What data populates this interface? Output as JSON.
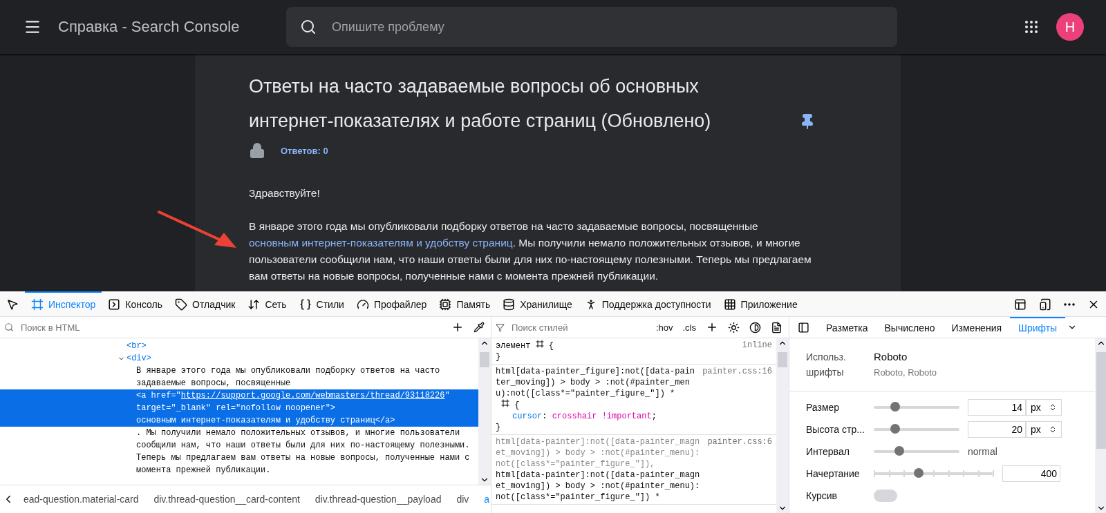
{
  "header": {
    "title": "Справка - Search Console",
    "search_placeholder": "Опишите проблему",
    "avatar_letter": "Н"
  },
  "post": {
    "title": "Ответы на часто задаваемые вопросы об основных интернет-показателях и работе страниц (Обновлено)",
    "replies": "Ответов: 0",
    "greeting": "Здравствуйте!",
    "paragraph_start": "В январе этого года мы опубликовали подборку ответов на часто задаваемые вопросы, посвященные ",
    "paragraph_link": "основным интернет-показателям и удобству страниц",
    "paragraph_end": ". Мы получили немало положительных отзывов, и многие пользователи сообщили нам, что наши ответы были для них по-настоящему полезными. Теперь мы предлагаем вам ответы на новые вопросы, полученные нами с момента прежней публикации."
  },
  "devtools": {
    "tabs": [
      {
        "kind": "inspector",
        "label": "Инспектор",
        "selected": true
      },
      {
        "kind": "console",
        "label": "Консоль",
        "selected": false
      },
      {
        "kind": "debugger",
        "label": "Отладчик",
        "selected": false
      },
      {
        "kind": "network",
        "label": "Сеть",
        "selected": false
      },
      {
        "kind": "styles",
        "label": "Стили",
        "selected": false
      },
      {
        "kind": "profiler",
        "label": "Профайлер",
        "selected": false
      },
      {
        "kind": "memory",
        "label": "Память",
        "selected": false
      },
      {
        "kind": "storage",
        "label": "Хранилище",
        "selected": false
      },
      {
        "kind": "accessibility",
        "label": "Поддержка доступности",
        "selected": false
      },
      {
        "kind": "application",
        "label": "Приложение",
        "selected": false
      }
    ],
    "html_search_placeholder": "Поиск в HTML",
    "html_nodes": [
      {
        "kind": "tag",
        "text": "<br>"
      },
      {
        "kind": "tag",
        "text": "<div>",
        "expanded": true
      },
      {
        "kind": "text",
        "text": "В январе этого года мы опубликовали подборку ответов на часто задаваемые вопросы, посвященные",
        "selected": false
      },
      {
        "kind": "element",
        "selected": true,
        "tag_start": "<a href=\"",
        "url": "https://support.google.com/webmasters/thread/93118226",
        "tag_quote": "\"",
        "attrs": "target=\"_blank\" rel=\"nofollow noopener\">",
        "content": "основным интернет-показателям и удобству страниц</a>"
      },
      {
        "kind": "text",
        "text": ". Мы получили немало положительных отзывов, и многие пользователи сообщили нам, что наши ответы были для них по-настоящему полезными. Теперь мы предлагаем вам ответы на новые вопросы, полученные нами с момента прежней публикации.",
        "selected": false
      }
    ],
    "breadcrumbs": [
      {
        "label": "ead-question.material-card",
        "selected": false
      },
      {
        "label": "div.thread-question__card-content",
        "selected": false
      },
      {
        "label": "div.thread-question__payload",
        "selected": false
      },
      {
        "label": "div",
        "selected": false
      },
      {
        "label": "a",
        "selected": true
      }
    ],
    "rules_search_placeholder": "Поиск стилей",
    "rules_buttons": [
      ":hov",
      ".cls"
    ],
    "rules": [
      {
        "kind": "element",
        "selector": "элемент",
        "source": "inline",
        "open_brace": "{",
        "close_brace": "}"
      },
      {
        "kind": "rule",
        "selector": "html[data-painter_figure]:not([data-painter_moving]) > body > :not(#painter_menu):not([class*=\"painter_figure_\"]) *",
        "source": "painter.css:16",
        "open_brace": "{",
        "close_brace": "}",
        "declarations": [
          {
            "property": "cursor",
            "colon": ":",
            "value": "crosshair !important",
            "semicolon": ";"
          }
        ]
      },
      {
        "kind": "rule",
        "source": "painter.css:6",
        "selector_parts": [
          {
            "text": "html[data-painter]:not([data-painter_magnet_moving]) > body > :not(#painter_menu):not([class*=\"painter_figure_\"]),",
            "matched": false
          },
          {
            "text": "html[data-painter]:not([data-painter_magnet_moving]) > body > :not(#painter_menu):not([class*=\"painter_figure_\"]) *",
            "matched": true
          }
        ]
      }
    ],
    "side_tabs": [
      {
        "label": "Разметка",
        "selected": false
      },
      {
        "label": "Вычислено",
        "selected": false
      },
      {
        "label": "Изменения",
        "selected": false
      },
      {
        "label": "Шрифты",
        "selected": true
      }
    ],
    "fonts": {
      "used_label": "Использ. шрифты",
      "font_name": "Roboto",
      "font_family": "Roboto, Roboto",
      "controls": [
        {
          "kind": "slider",
          "label": "Размер",
          "level": 0.25,
          "value": "14",
          "unit": "px"
        },
        {
          "kind": "slider",
          "label": "Высота стр...",
          "level": 0.25,
          "value": "20",
          "unit": "px"
        },
        {
          "kind": "reading",
          "label": "Интервал",
          "level": 0.3,
          "reading": "normal"
        },
        {
          "kind": "steps",
          "label": "Начертание",
          "level": 0.38,
          "value": "400"
        },
        {
          "kind": "toggle",
          "label": "Курсив",
          "on": false
        }
      ]
    }
  }
}
